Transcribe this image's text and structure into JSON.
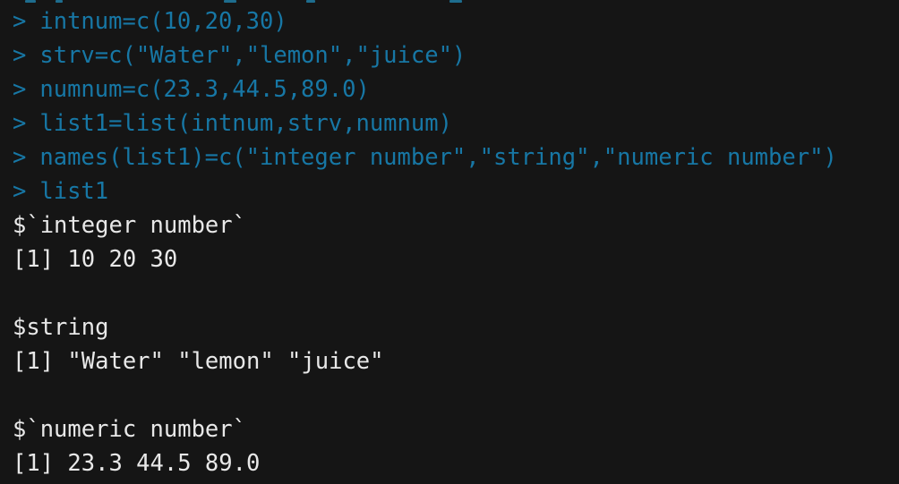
{
  "console": {
    "prompt_symbol": ">",
    "colors": {
      "background": "#151515",
      "input_text": "#1777a5",
      "output_text": "#e8e8e8"
    },
    "lines": [
      {
        "kind": "input",
        "text": "intnum=c(10,20,30)"
      },
      {
        "kind": "input",
        "text": "strv=c(\"Water\",\"lemon\",\"juice\")"
      },
      {
        "kind": "input",
        "text": "numnum=c(23.3,44.5,89.0)"
      },
      {
        "kind": "input",
        "text": "list1=list(intnum,strv,numnum)"
      },
      {
        "kind": "input",
        "text": "names(list1)=c(\"integer number\",\"string\",\"numeric number\")"
      },
      {
        "kind": "input",
        "text": "list1"
      },
      {
        "kind": "output",
        "text": "$`integer number`"
      },
      {
        "kind": "output",
        "text": "[1] 10 20 30"
      },
      {
        "kind": "blank",
        "text": ""
      },
      {
        "kind": "output",
        "text": "$string"
      },
      {
        "kind": "output",
        "text": "[1] \"Water\" \"lemon\" \"juice\""
      },
      {
        "kind": "blank",
        "text": ""
      },
      {
        "kind": "output",
        "text": "$`numeric number`"
      },
      {
        "kind": "output",
        "text": "[1] 23.3 44.5 89.0"
      }
    ]
  }
}
